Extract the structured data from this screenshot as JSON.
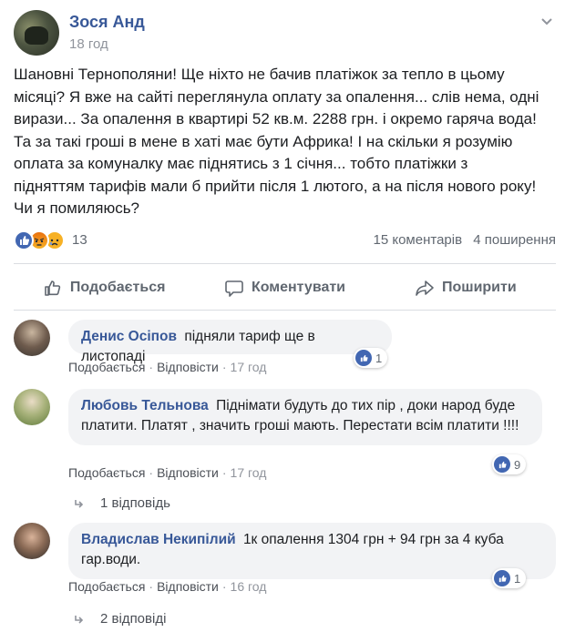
{
  "post": {
    "author": "Зося Анд",
    "time": "18 год",
    "text": "Шановні Тернополяни! Ще ніхто не бачив платіжок за тепло в цьому\nмісяці? Я вже на сайті переглянула оплату за опалення... слів нема, одні\nвирази... За опалення в квартирі 52 кв.м. 2288 грн. і окремо гаряча вода!\nТа за такі гроші в мене в хаті має бути Африка! І на скільки я розумію\nоплата за комуналку має піднятись з 1 січня... тобто платіжки з\nпідняттям тарифів мали б прийти після 1 лютого, а на після нового року!\nЧи я помиляюсь?",
    "reaction_count": "13",
    "comments_count": "15 коментарів",
    "shares_count": "4 поширення",
    "reaction_icons": [
      "like",
      "angry",
      "sad"
    ]
  },
  "actions": {
    "like": "Подобається",
    "comment": "Коментувати",
    "share": "Поширити"
  },
  "comments": [
    {
      "name": "Денис Осіпов",
      "text": "підняли тариф ще в листопаді",
      "likes": "1",
      "like_label": "Подобається",
      "reply_label": "Відповісти",
      "time": "17 год"
    },
    {
      "name": "Любовь Тельнова",
      "text": "Піднімати будуть до тих пір , доки народ буде платити. Платят , значить гроші мають. Перестати всім платити !!!!",
      "likes": "9",
      "like_label": "Подобається",
      "reply_label": "Відповісти",
      "time": "17 год",
      "replies": "1 відповідь"
    },
    {
      "name": "Владислав Некипілий",
      "text": "1к опалення 1304 грн + 94 грн за 4 куба гар.води.",
      "likes": "1",
      "like_label": "Подобається",
      "reply_label": "Відповісти",
      "time": "16 год",
      "replies": "2 відповіді"
    }
  ],
  "colors": {
    "name_link": "#385898",
    "meta": "#90949c",
    "like_blue": "#4267b2",
    "bubble": "#f2f3f5"
  }
}
